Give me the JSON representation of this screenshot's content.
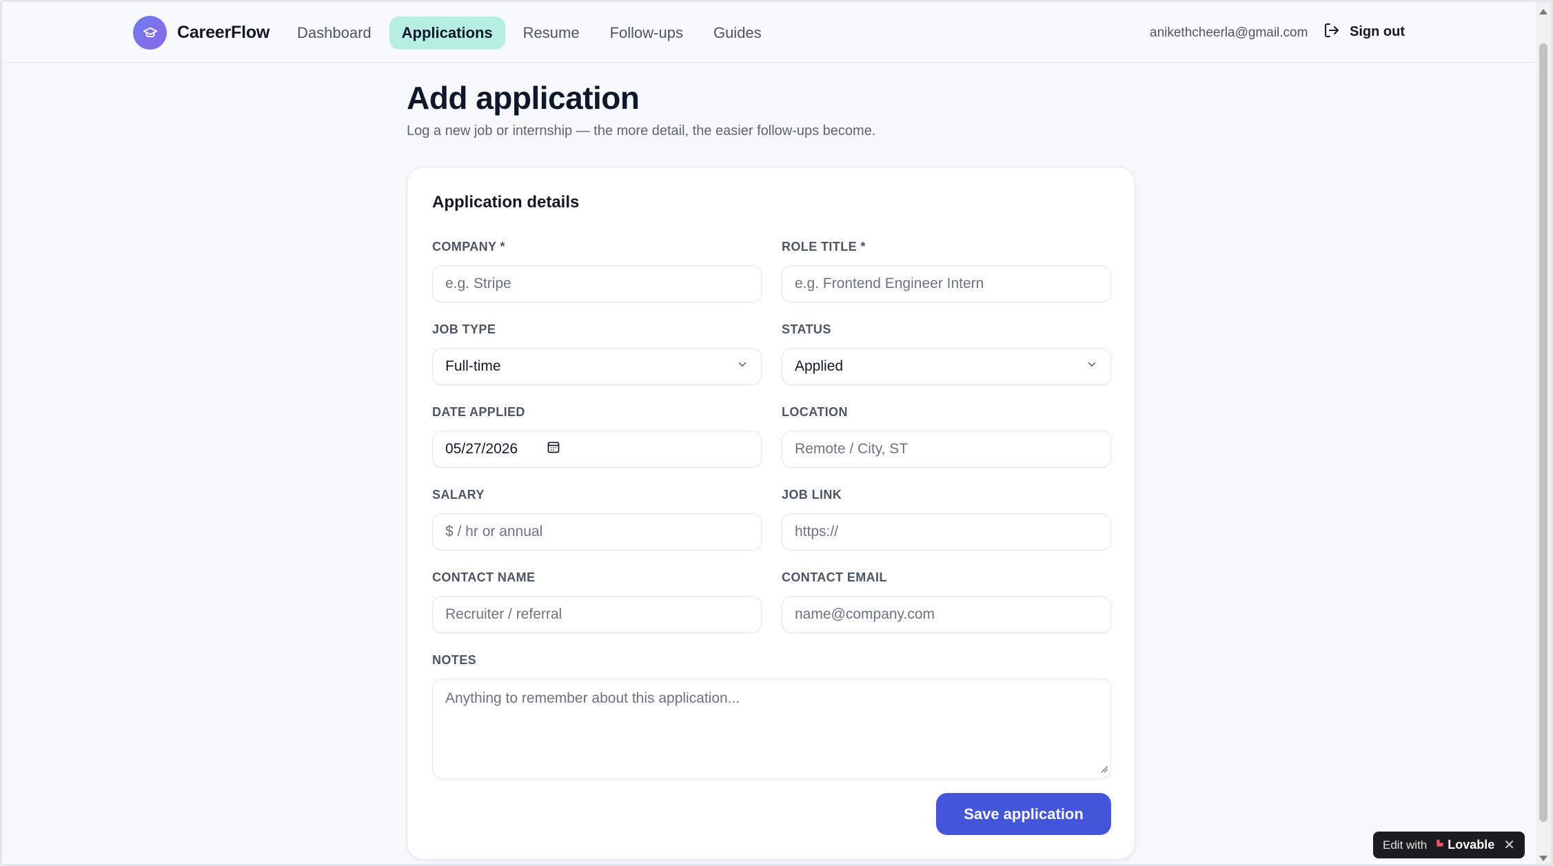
{
  "brand": {
    "name": "CareerFlow",
    "logo_icon": "graduation-cap-icon"
  },
  "nav": {
    "items": [
      {
        "label": "Dashboard",
        "active": false
      },
      {
        "label": "Applications",
        "active": true
      },
      {
        "label": "Resume",
        "active": false
      },
      {
        "label": "Follow-ups",
        "active": false
      },
      {
        "label": "Guides",
        "active": false
      }
    ]
  },
  "user": {
    "email": "anikethcheerla@gmail.com",
    "signout_label": "Sign out",
    "signout_icon": "log-out-icon"
  },
  "page": {
    "title": "Add application",
    "subtitle": "Log a new job or internship — the more detail, the easier follow-ups become."
  },
  "form": {
    "card_title": "Application details",
    "company": {
      "label": "COMPANY *",
      "placeholder": "e.g. Stripe"
    },
    "role_title": {
      "label": "ROLE TITLE *",
      "placeholder": "e.g. Frontend Engineer Intern"
    },
    "job_type": {
      "label": "JOB TYPE",
      "value": "Full-time",
      "icon": "chevron-down-icon"
    },
    "status": {
      "label": "STATUS",
      "value": "Applied",
      "icon": "chevron-down-icon"
    },
    "date_applied": {
      "label": "DATE APPLIED",
      "value": "05/27/2026",
      "icon": "calendar-icon"
    },
    "location": {
      "label": "LOCATION",
      "placeholder": "Remote / City, ST"
    },
    "salary": {
      "label": "SALARY",
      "placeholder": "$ / hr or annual"
    },
    "job_link": {
      "label": "JOB LINK",
      "placeholder": "https://"
    },
    "contact_name": {
      "label": "CONTACT NAME",
      "placeholder": "Recruiter / referral"
    },
    "contact_email": {
      "label": "CONTACT EMAIL",
      "placeholder": "name@company.com"
    },
    "notes": {
      "label": "NOTES",
      "placeholder": "Anything to remember about this application..."
    },
    "save_label": "Save application"
  },
  "badge": {
    "prefix": "Edit with",
    "brand": "Lovable",
    "close": "✕"
  },
  "colors": {
    "accent": "#4356d9",
    "active_nav_bg": "#b6efe2",
    "logo_gradient_start": "#6e7cf0",
    "logo_gradient_end": "#8e67e8",
    "page_bg": "#f7f8fb"
  }
}
